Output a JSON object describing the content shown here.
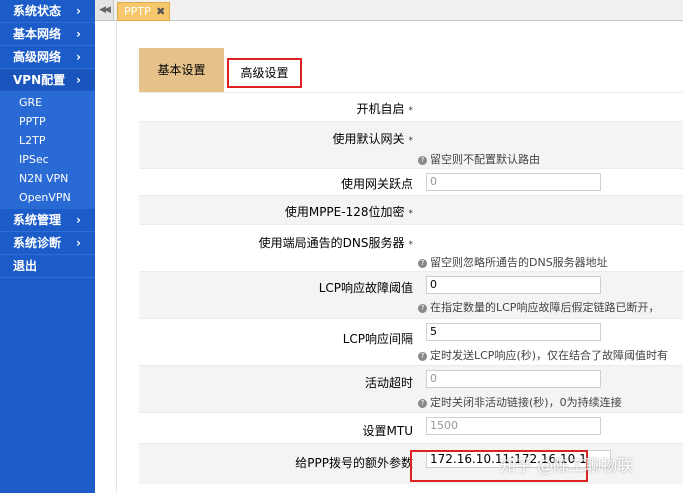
{
  "sidebar": {
    "items": [
      {
        "label": "系统状态",
        "arrow": "›"
      },
      {
        "label": "基本网络",
        "arrow": "›"
      },
      {
        "label": "高级网络",
        "arrow": "›"
      },
      {
        "label": "VPN配置",
        "arrow": "›"
      }
    ],
    "vpn_sub": [
      "GRE",
      "PPTP",
      "L2TP",
      "IPSec",
      "N2N VPN",
      "OpenVPN"
    ],
    "bottom_items": [
      {
        "label": "系统管理",
        "arrow": "›"
      },
      {
        "label": "系统诊断",
        "arrow": "›"
      },
      {
        "label": "退出",
        "arrow": ""
      }
    ]
  },
  "tabbar": {
    "back_icon": "◀◀",
    "page_tab": "PPTP",
    "close_icon": "✖"
  },
  "config_tabs": {
    "basic": "基本设置",
    "advanced": "高级设置"
  },
  "form": {
    "auto_start": {
      "label": "开机自启",
      "star": "*"
    },
    "default_gw": {
      "label": "使用默认网关",
      "star": "*",
      "help": "留空则不配置默认路由"
    },
    "gw_hop": {
      "label": "使用网关跃点",
      "value": "0"
    },
    "mppe": {
      "label": "使用MPPE-128位加密",
      "star": "*"
    },
    "peer_dns": {
      "label": "使用端局通告的DNS服务器",
      "star": "*",
      "help": "留空则忽略所通告的DNS服务器地址"
    },
    "lcp_fail": {
      "label": "LCP响应故障阈值",
      "value": "0",
      "help": "在指定数量的LCP响应故障后假定链路已断开，"
    },
    "lcp_interval": {
      "label": "LCP响应间隔",
      "value": "5",
      "help": "定时发送LCP响应(秒)，仅在结合了故障阈值时有"
    },
    "idle_timeout": {
      "label": "活动超时",
      "value": "0",
      "help": "定时关闭非活动链接(秒)，0为持续连接"
    },
    "mtu": {
      "label": "设置MTU",
      "value": "1500"
    },
    "ppp_extra": {
      "label": "给PPP拨号的额外参数",
      "value": "172.16.10.11:172.16.10.1"
    }
  },
  "watermark": "知乎 @陈工聊物联",
  "colors": {
    "sidebar_bg": "#1b5cc9",
    "tab_active_bg": "#e6c28a",
    "highlight_red": "#dd2222",
    "page_tab_bg": "#f7c76c"
  }
}
